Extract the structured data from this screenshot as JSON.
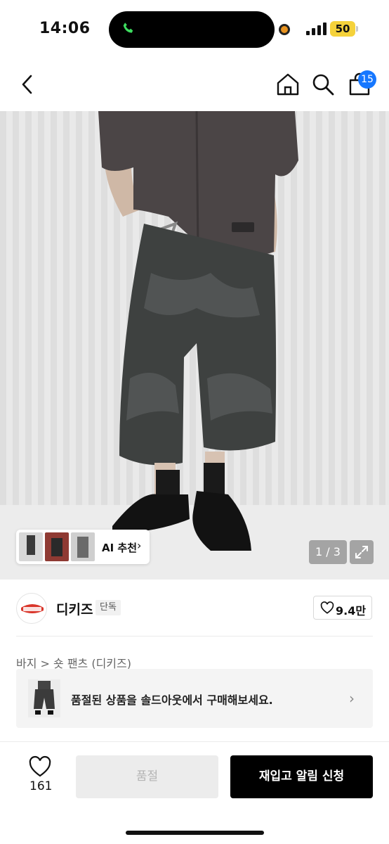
{
  "status_bar": {
    "time": "14:06",
    "battery": "50"
  },
  "nav": {
    "cart_count": "15"
  },
  "gallery": {
    "ai_label": "AI 추천",
    "ai_chevron": "›",
    "counter": "1 / 3"
  },
  "brand": {
    "name": "디키즈",
    "badge": "단독",
    "likes": "9.4만"
  },
  "breadcrumb": "바지 > 숏 팬츠 (디키즈)",
  "soldout_card": {
    "text": "품절된 상품을 솔드아웃에서 구매해보세요.",
    "chevron": "›"
  },
  "bottom_bar": {
    "heart_count": "161",
    "soldout_label": "품절",
    "notify_label": "재입고 알림 신청"
  },
  "colors": {
    "accent_blue": "#1677ff",
    "battery_yellow": "#f5d23b",
    "primary_black": "#000000"
  },
  "icons": [
    "phone-icon",
    "recording-dot-icon",
    "signal-icon",
    "battery-icon",
    "back-chevron-icon",
    "home-icon",
    "search-icon",
    "cart-icon",
    "expand-icon",
    "heart-icon",
    "chevron-right-icon"
  ]
}
